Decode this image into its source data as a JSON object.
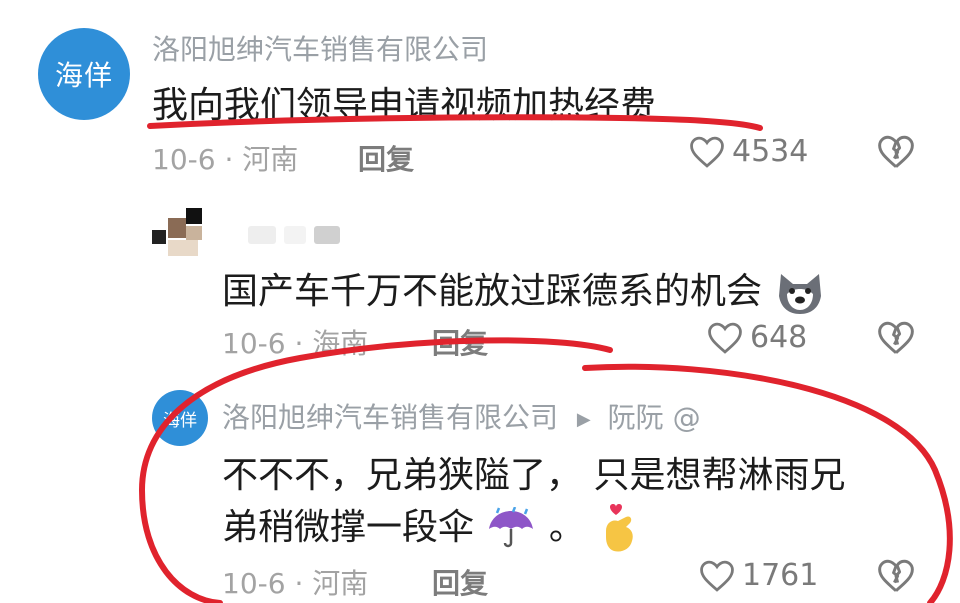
{
  "comment1": {
    "avatar_text": "海佯",
    "author": "洛阳旭绅汽车销售有限公司",
    "text": "我向我们领导申请视频加热经费",
    "date_location": "10-6 · 河南",
    "reply_label": "回复",
    "likes": "4534"
  },
  "comment2": {
    "text": "国产车千万不能放过踩德系的机会",
    "emoji": "dog-face-emoji",
    "date_location": "10-6 · 海南",
    "reply_label": "回复",
    "likes": "648"
  },
  "comment3": {
    "avatar_text": "海佯",
    "author": "洛阳旭绅汽车销售有限公司",
    "reply_to": "阮阮 @",
    "text_line1": "不不不，兄弟狭隘了， 只是想帮淋雨兄",
    "text_line2": "弟稍微撑一段伞",
    "text_end": "。",
    "date_location": "10-6 · 河南",
    "reply_label": "回复",
    "likes": "1761"
  },
  "colors": {
    "avatar_blue": "#2f8fd8",
    "annotation_red": "#e0232d",
    "meta_gray": "#a3a3a3"
  }
}
